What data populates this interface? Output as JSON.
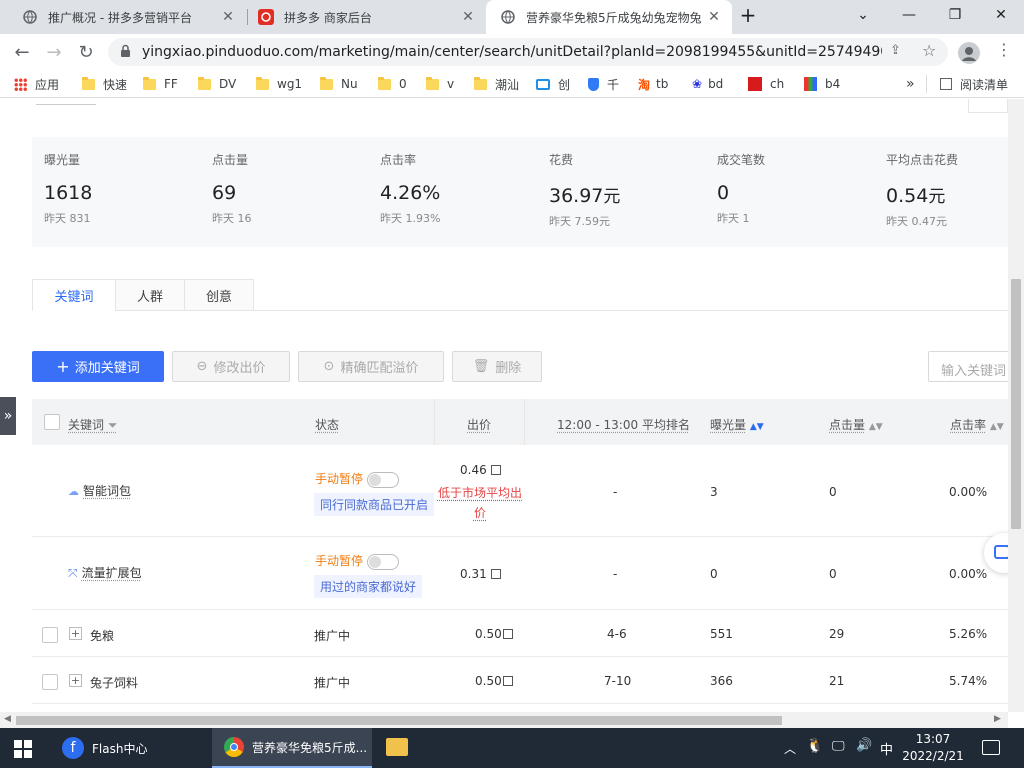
{
  "browser": {
    "tabs": [
      {
        "title": "推广概况 - 拼多多营销平台",
        "icon": "pdd-promo-icon"
      },
      {
        "title": "拼多多 商家后台",
        "icon": "pdd-merchant-icon"
      },
      {
        "title": "营养豪华免粮5斤成兔幼兔宠物兔",
        "icon": "pdd-promo-icon"
      }
    ],
    "url": "yingxiao.pinduoduo.com/marketing/main/center/search/unitDetail?planId=2098199455&unitId=257494901...",
    "bookmarks": [
      "应用",
      "快速",
      "FF",
      "DV",
      "wg1",
      "Nu",
      "0",
      "v",
      "潮汕",
      "创",
      "千",
      "tb",
      "bd",
      "ch",
      "b4"
    ],
    "reading_list": "阅读清单",
    "more": "»"
  },
  "stats": [
    {
      "label": "曝光量",
      "value": "1618",
      "unit": "",
      "yesterday": "昨天 831"
    },
    {
      "label": "点击量",
      "value": "69",
      "unit": "",
      "yesterday": "昨天 16"
    },
    {
      "label": "点击率",
      "value": "4.26%",
      "unit": "",
      "yesterday": "昨天 1.93%"
    },
    {
      "label": "花费",
      "value": "36.97",
      "unit": "元",
      "yesterday": "昨天 7.59元"
    },
    {
      "label": "成交笔数",
      "value": "0",
      "unit": "",
      "yesterday": "昨天 1"
    },
    {
      "label": "平均点击花费",
      "value": "0.54",
      "unit": "元",
      "yesterday": "昨天 0.47元"
    }
  ],
  "tabs": [
    "关键词",
    "人群",
    "创意"
  ],
  "actions": {
    "add_keyword": "添加关键词",
    "modify_bid": "修改出价",
    "exact_match": "精确匹配溢价",
    "delete": "删除",
    "search_placeholder": "输入关键词"
  },
  "table": {
    "headers": [
      "关键词",
      "状态",
      "出价",
      "12:00 - 13:00 平均排名",
      "曝光量",
      "点击量",
      "点击率"
    ],
    "special_rows": [
      {
        "name": "智能词包",
        "status": "手动暂停",
        "hint": "同行同款商品已开启",
        "bid": "0.46",
        "warn": "低于市场平均出价",
        "rank": "-",
        "impressions": "3",
        "clicks": "0",
        "ctr": "0.00%"
      },
      {
        "name": "流量扩展包",
        "status": "手动暂停",
        "hint": "用过的商家都说好",
        "bid": "0.31",
        "rank": "-",
        "impressions": "0",
        "clicks": "0",
        "ctr": "0.00%"
      }
    ],
    "rows": [
      {
        "keyword": "免粮",
        "status": "推广中",
        "bid": "0.50",
        "rank": "4-6",
        "impressions": "551",
        "clicks": "29",
        "ctr": "5.26%"
      },
      {
        "keyword": "兔子饲料",
        "status": "推广中",
        "bid": "0.50",
        "rank": "7-10",
        "impressions": "366",
        "clicks": "21",
        "ctr": "5.74%"
      }
    ]
  },
  "taskbar": {
    "flash": "Flash中心",
    "chrome": "营养豪华免粮5斤成...",
    "ime": "中",
    "time": "13:07",
    "date": "2022/2/21"
  }
}
